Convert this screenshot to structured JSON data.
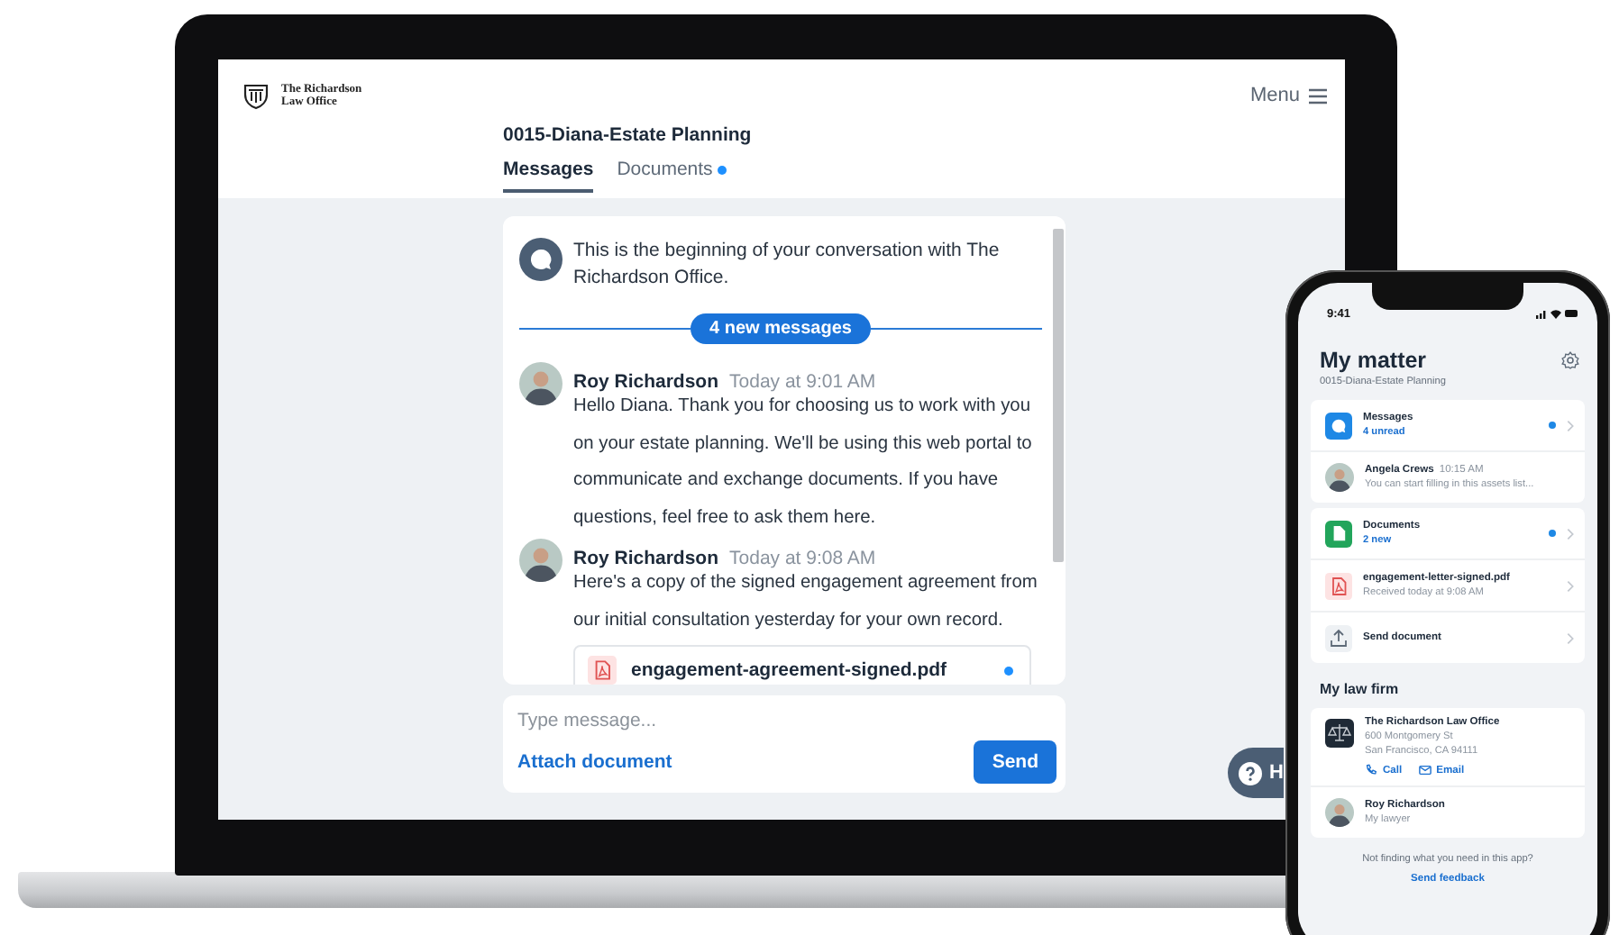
{
  "laptop": {
    "firm_name": "The Richardson Law Office",
    "menu": "Menu",
    "matter_title": "0015-Diana-Estate Planning",
    "tabs": [
      {
        "label": "Messages",
        "selected": true,
        "unread": false
      },
      {
        "label": "Documents",
        "selected": false,
        "unread": true
      }
    ],
    "conversation": {
      "intro": "This is the beginning of your conversation with The Richardson Office.",
      "divider": "4 new messages",
      "messages": [
        {
          "author": "Roy Richardson",
          "time": "Today at 9:01 AM",
          "text": "Hello Diana. Thank you for choosing us to work with you on your estate planning. We'll be using this web portal to communicate and exchange documents. If you have questions, feel free to ask them here."
        },
        {
          "author": "Roy Richardson",
          "time": "Today at 9:08 AM",
          "text": "Here's a copy of the signed engagement agreement from our initial consultation yesterday for your own record.",
          "attachment": {
            "name": "engagement-agreement-signed.pdf",
            "unread": true
          }
        }
      ]
    },
    "composer": {
      "placeholder": "Type message...",
      "attach": "Attach document",
      "send": "Send"
    },
    "help": "H"
  },
  "phone": {
    "status_time": "9:41",
    "title": "My matter",
    "subtitle": "0015-Diana-Estate Planning",
    "sections": [
      {
        "items": [
          {
            "kind": "category",
            "color": "#1e88e5",
            "title": "Messages",
            "detail": "4 unread",
            "unread": true
          },
          {
            "kind": "person",
            "title": "Angela Crews",
            "time": "10:15 AM",
            "detail": "You can start filling in this assets list..."
          }
        ]
      },
      {
        "items": [
          {
            "kind": "category",
            "color": "#22a55b",
            "title": "Documents",
            "detail": "2 new",
            "unread": true
          },
          {
            "kind": "file",
            "title": "engagement-letter-signed.pdf",
            "detail": "Received today at 9:08 AM"
          },
          {
            "kind": "action",
            "title": "Send document"
          }
        ]
      }
    ],
    "firm_heading": "My law firm",
    "firm": {
      "name": "The Richardson Law Office",
      "address": [
        "600 Montgomery St",
        "San Francisco, CA 94111"
      ],
      "actions": [
        {
          "kind": "call",
          "label": "Call"
        },
        {
          "kind": "email",
          "label": "Email"
        }
      ]
    },
    "lawyer": {
      "name": "Roy Richardson",
      "role": "My lawyer"
    },
    "footer": "Not finding what you need in this app?",
    "feedback": "Send feedback"
  }
}
